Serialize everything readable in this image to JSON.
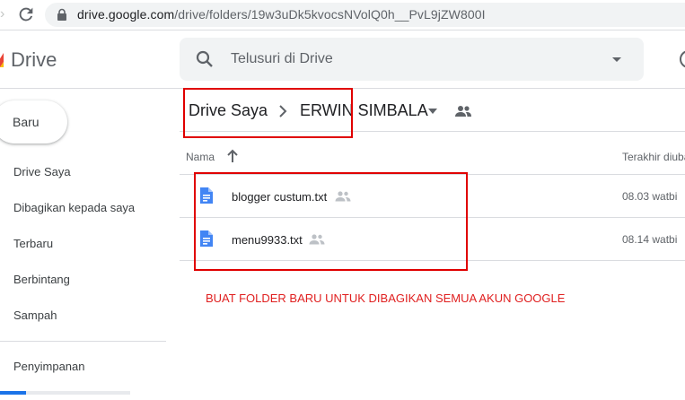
{
  "browser": {
    "url_host": "drive.google.com",
    "url_path": "/drive/folders/19w3uDk5kvocsNVolQ0h__PvL9jZW800I"
  },
  "header": {
    "app_title": "Drive",
    "search_placeholder": "Telusuri di Drive"
  },
  "sidebar": {
    "new_label": "Baru",
    "items": [
      {
        "label": "Drive Saya"
      },
      {
        "label": "Dibagikan kepada saya"
      },
      {
        "label": "Terbaru"
      },
      {
        "label": "Berbintang"
      },
      {
        "label": "Sampah"
      }
    ],
    "storage_label": "Penyimpanan",
    "storage_used_fraction": 0.2
  },
  "breadcrumb": {
    "root": "Drive Saya",
    "folder": "ERWIN SIMBALA"
  },
  "columns": {
    "name": "Nama",
    "modified": "Terakhir diubah"
  },
  "files": [
    {
      "name": "blogger custum.txt",
      "modified": "08.03",
      "owner": "watbi"
    },
    {
      "name": "menu9933.txt",
      "modified": "08.14",
      "owner": "watbi"
    }
  ],
  "annotation": {
    "note": "BUAT FOLDER BARU UNTUK DIBAGIKAN SEMUA AKUN GOOGLE",
    "color": "#e00000"
  },
  "colors": {
    "accent": "#1a73e8",
    "doc_icon": "#4285f4"
  }
}
